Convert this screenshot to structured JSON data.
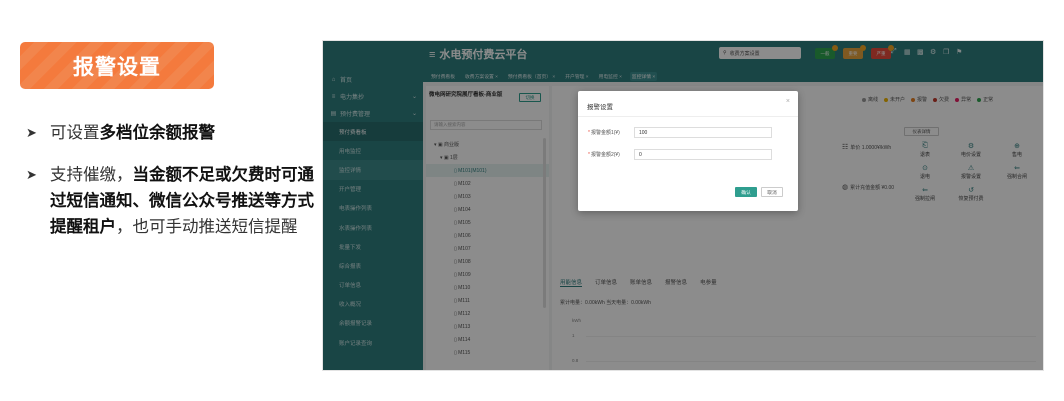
{
  "promo": {
    "badge": "报警设置",
    "bullet1_plain": "可设置",
    "bullet1_bold": "多档位余额报警",
    "bullet2_plain1": "支持催缴，",
    "bullet2_bold": "当金额不足或欠费时可通过短信通知、微信公众号推送等方式提醒租户",
    "bullet2_plain2": "，也可手动推送短信提醒"
  },
  "app": {
    "title": "水电预付费云平台",
    "search_placeholder": "收费方案设置",
    "exit": "退出",
    "pills": [
      {
        "label": "一般",
        "color": "#2ea44f"
      },
      {
        "label": "重要",
        "color": "#e6a23c"
      },
      {
        "label": "严重",
        "color": "#e74c3c"
      }
    ]
  },
  "sidebar": {
    "items": [
      {
        "icon": "⌂",
        "label": "首页"
      },
      {
        "icon": "≡",
        "label": "电力集抄"
      },
      {
        "icon": "▤",
        "label": "预付费管理"
      }
    ],
    "subitems": [
      "预付费看板",
      "用电监控",
      "监控详情",
      "开户管理",
      "电表操作列表",
      "水表操作列表",
      "批量下发",
      "综合报表",
      "订单信息",
      "收入概况",
      "余额报警记录",
      "账户记录查询"
    ]
  },
  "tabs": [
    "预付费看板",
    "收费方案设置",
    "预付费看板（首页）",
    "开户管理",
    "用电监控",
    "监控详情"
  ],
  "tree": {
    "header": "微电网研究院展厅看板-商业版",
    "switch": "切换",
    "search_placeholder": "请输入搜索内容",
    "nodes": [
      "商业版",
      "1层",
      "M101(M101)",
      "M102",
      "M103",
      "M104",
      "M105",
      "M106",
      "M107",
      "M108",
      "M109",
      "M110",
      "M111",
      "M112",
      "M113",
      "M114",
      "M115"
    ]
  },
  "main": {
    "legend": [
      {
        "label": "离线",
        "color": "#999999"
      },
      {
        "label": "未开户",
        "color": "#f0b400"
      },
      {
        "label": "报警",
        "color": "#e67e22"
      },
      {
        "label": "欠费",
        "color": "#c0392b"
      },
      {
        "label": "异常",
        "color": "#e91e63"
      },
      {
        "label": "正常",
        "color": "#2ea44f"
      }
    ],
    "detail_btn": "仪表详情",
    "unit_price_label": "单价",
    "unit_price": "1.0000¥/kWh",
    "charge_label": "累计充值金额",
    "charge_value": "¥0.00",
    "actions": [
      "退表",
      "电价设置",
      "售电",
      "退电",
      "报警设置",
      "强制合闸",
      "强制拉闸",
      "恢复预付费"
    ],
    "subtabs": [
      "用能信息",
      "订单信息",
      "账单信息",
      "报警信息",
      "电参量"
    ],
    "totals": "累计电量：0.00kWh      当天电量：0.00kWh",
    "y_unit": "kWh",
    "y_ticks": [
      "1",
      "0.8",
      "0.6",
      "0.4"
    ]
  },
  "modal": {
    "title": "报警设置",
    "close": "×",
    "field1_label": "报警金额1(¥)",
    "field1_value": "100",
    "field2_label": "报警金额2(¥)",
    "field2_value": "0",
    "ok": "确认",
    "cancel": "取消"
  }
}
